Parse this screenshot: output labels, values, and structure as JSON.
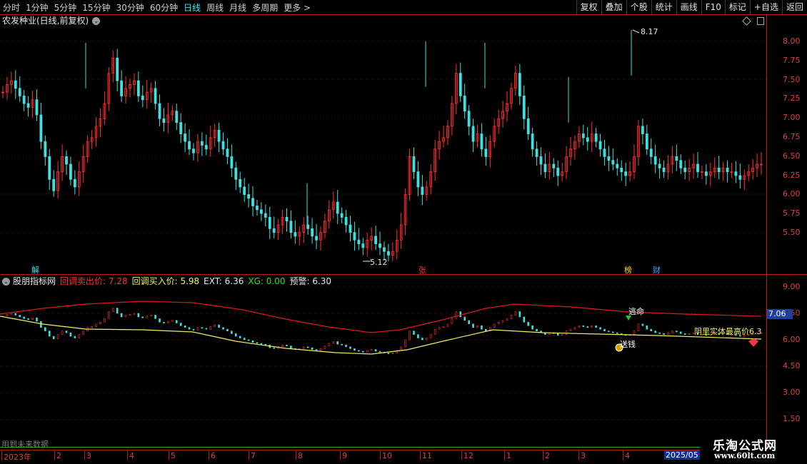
{
  "toolbar": {
    "periods": [
      "分时",
      "1分钟",
      "5分钟",
      "15分钟",
      "30分钟",
      "60分钟",
      "日线",
      "周线",
      "月线",
      "多周期",
      "更多 >"
    ],
    "active_period": "日线",
    "buttons": [
      "复权",
      "叠加",
      "个股",
      "统计",
      "画线",
      "F10",
      "标记",
      "+自选",
      "返回"
    ]
  },
  "main_chart": {
    "title": "农发种业(日线,前复权)",
    "price_labels": [
      "8.00",
      "7.75",
      "7.50",
      "7.25",
      "7.00",
      "6.75",
      "6.50",
      "6.25",
      "6.00",
      "5.75",
      "5.50"
    ],
    "high_label": "8.17",
    "low_label": "5.12",
    "markers": [
      "解",
      "张",
      "榜",
      "财"
    ]
  },
  "indicator": {
    "name": "股朋指标网",
    "sell_label": "回调卖出价: 7.28",
    "buy_label": "回调买入价: 5.98",
    "ext_label": "EXT: 6.36",
    "xg_label": "XG: 0.00",
    "warn_label": "预警: 6.30",
    "axis_labels": [
      "9.00",
      "7.50",
      "6.00",
      "4.50",
      "3.00",
      "1.50"
    ],
    "current_badge": "7.06",
    "escape_label": "逃命",
    "money_label": "送钱",
    "yin_label": "阴里实体最高价6.3"
  },
  "time_axis": {
    "labels": [
      "2023年",
      "2",
      "3",
      "4",
      "5",
      "6",
      "7",
      "8",
      "9",
      "10",
      "11",
      "12",
      "1",
      "2",
      "3",
      "4"
    ],
    "end_label": "2025/05"
  },
  "footer": {
    "future_note": "用到未来数据",
    "watermark_title": "乐淘公式网",
    "watermark_url": "www.60lt.com"
  },
  "colors": {
    "up": "#ff3030",
    "down": "#40e0e0",
    "sell_line": "#e01818",
    "buy_line": "#f0f060",
    "axis": "#e04040"
  },
  "chart_data": {
    "type": "candlestick",
    "ylim": [
      5.12,
      8.17
    ],
    "closes": [
      7.35,
      7.45,
      7.5,
      7.4,
      7.3,
      7.2,
      7.15,
      7.25,
      7.05,
      6.7,
      6.5,
      6.2,
      6.05,
      6.3,
      6.5,
      6.4,
      6.2,
      6.1,
      6.3,
      6.5,
      6.7,
      6.75,
      6.9,
      7.0,
      7.2,
      7.6,
      7.8,
      7.5,
      7.3,
      7.4,
      7.45,
      7.5,
      7.3,
      7.25,
      7.35,
      7.4,
      7.2,
      7.0,
      6.95,
      7.05,
      7.1,
      6.95,
      6.8,
      6.7,
      6.6,
      6.55,
      6.7,
      6.65,
      6.6,
      6.75,
      6.85,
      6.7,
      6.6,
      6.5,
      6.35,
      6.2,
      6.1,
      6.0,
      5.95,
      5.85,
      5.8,
      5.75,
      5.7,
      5.55,
      5.5,
      5.6,
      5.7,
      5.65,
      5.5,
      5.45,
      5.5,
      5.6,
      5.55,
      5.45,
      5.4,
      5.5,
      5.65,
      5.8,
      5.9,
      5.75,
      5.7,
      5.6,
      5.5,
      5.4,
      5.35,
      5.3,
      5.4,
      5.45,
      5.35,
      5.3,
      5.25,
      5.2,
      5.25,
      5.4,
      5.6,
      6.0,
      6.5,
      6.3,
      6.1,
      6.0,
      6.1,
      6.3,
      6.6,
      6.7,
      6.75,
      6.9,
      7.2,
      7.6,
      7.3,
      7.1,
      6.9,
      6.7,
      6.8,
      6.6,
      6.5,
      6.7,
      6.9,
      7.0,
      7.1,
      7.2,
      7.4,
      7.6,
      7.3,
      7.0,
      6.8,
      6.6,
      6.5,
      6.4,
      6.3,
      6.4,
      6.35,
      6.25,
      6.3,
      6.5,
      6.6,
      6.7,
      6.8,
      6.75,
      6.7,
      6.8,
      6.7,
      6.6,
      6.5,
      6.45,
      6.4,
      6.35,
      6.3,
      6.25,
      6.3,
      6.5,
      6.9,
      6.8,
      6.6,
      6.5,
      6.4,
      6.35,
      6.3,
      6.4,
      6.5,
      6.45,
      6.35,
      6.3,
      6.35,
      6.4,
      6.3,
      6.3,
      6.25,
      6.3,
      6.35,
      6.3,
      6.35,
      6.3,
      6.3,
      6.25,
      6.2,
      6.25,
      6.3,
      6.35,
      6.4,
      6.4
    ]
  }
}
